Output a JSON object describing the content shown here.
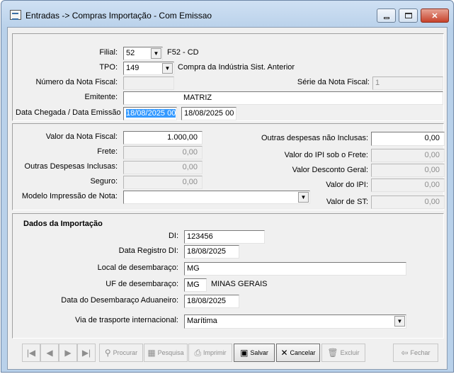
{
  "window": {
    "title": "Entradas -> Compras Importação - Com Emissao",
    "min_label": "",
    "max_label": "",
    "close_label": "✕"
  },
  "nota": {
    "filial_label": "Filial:",
    "filial_value": "52",
    "filial_desc": "F52 - CD",
    "tpo_label": "TPO:",
    "tpo_value": "149",
    "tpo_desc": "Compra da Indústria Sist. Anterior",
    "numero_label": "Número da Nota Fiscal:",
    "numero_value": "",
    "serie_label": "Série da Nota Fiscal:",
    "serie_value": "1",
    "emitente_label": "Emitente:",
    "emitente_value": "MATRIZ",
    "datas_label": "Data Chegada / Data Emissão",
    "data_chegada": "18/08/2025 00",
    "data_emissao": "18/08/2025 00"
  },
  "valores": {
    "valor_nf_label": "Valor da Nota Fiscal:",
    "valor_nf": "1.000,00",
    "frete_label": "Frete:",
    "frete": "0,00",
    "outras_inclusas_label": "Outras Despesas Inclusas:",
    "outras_inclusas": "0,00",
    "seguro_label": "Seguro:",
    "seguro": "0,00",
    "modelo_label": "Modelo Impressão de Nota:",
    "modelo_value": "",
    "outras_nao_inclusas_label": "Outras despesas não Inclusas:",
    "outras_nao_inclusas": "0,00",
    "ipi_frete_label": "Valor do IPI sob o Frete:",
    "ipi_frete": "0,00",
    "desconto_label": "Valor Desconto Geral:",
    "desconto": "0,00",
    "ipi_label": "Valor do IPI:",
    "ipi": "0,00",
    "st_label": "Valor de ST:",
    "st": "0,00"
  },
  "importacao": {
    "section_title": "Dados da Importação",
    "di_label": "DI:",
    "di_value": "123456",
    "data_registro_label": "Data Registro DI:",
    "data_registro": "18/08/2025",
    "local_label": "Local de desembaraço:",
    "local_value": "MG",
    "uf_label": "UF de desembaraço:",
    "uf_value": "MG",
    "uf_desc": "MINAS GERAIS",
    "data_desembaraco_label": "Data do Desembaraço Aduaneiro:",
    "data_desembaraco": "18/08/2025",
    "via_label": "Via de trasporte internacional:",
    "via_value": "Marítima"
  },
  "toolbar": {
    "first_glyph": "|◀",
    "prev_glyph": "◀",
    "next_glyph": "▶",
    "last_glyph": "▶|",
    "procurar": "Procurar",
    "pesquisa": "Pesquisa",
    "imprimir": "Imprimir",
    "salvar": "Salvar",
    "cancelar": "Cancelar",
    "excluir": "Excluir",
    "fechar": "Fechar"
  }
}
